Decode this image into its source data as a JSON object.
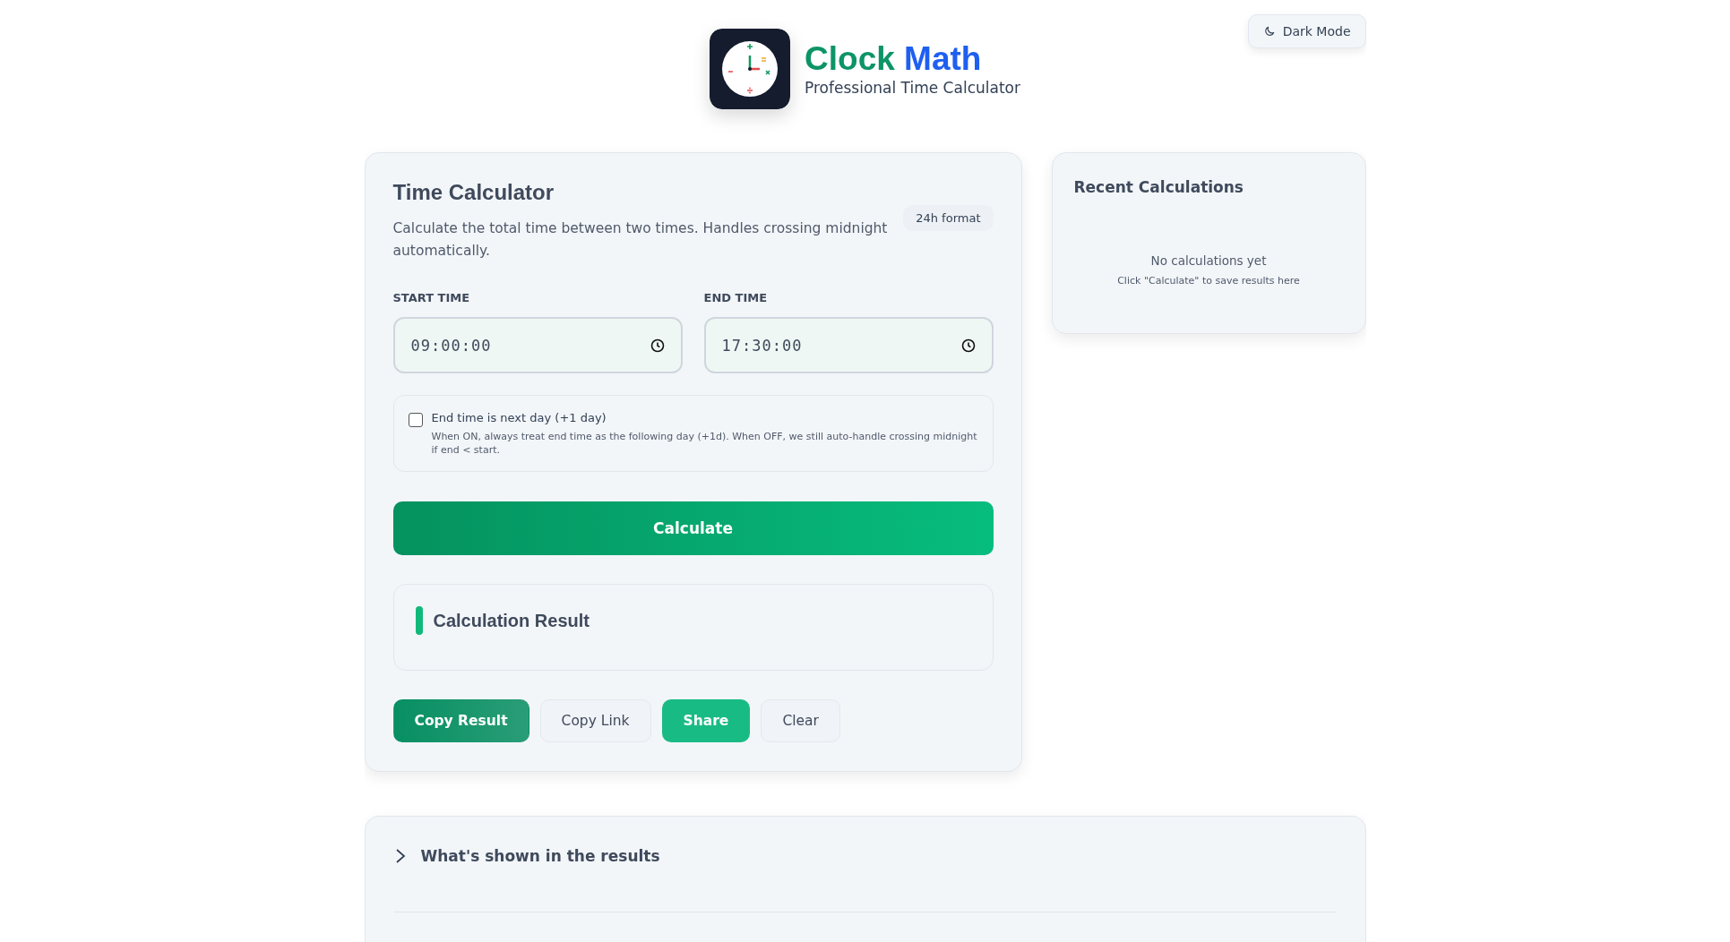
{
  "header": {
    "title_part1": "Clock",
    "title_part2": "Math",
    "subtitle": "Professional Time Calculator",
    "theme_button": "Dark Mode"
  },
  "calculator": {
    "title": "Time Calculator",
    "badge": "24h format",
    "description": "Calculate the total time between two times. Handles crossing midnight automatically.",
    "fields": [
      {
        "label": "START TIME",
        "value": "09:00:00"
      },
      {
        "label": "END TIME",
        "value": "17:30:00"
      }
    ],
    "next_day": {
      "label": "End time is next day (+1 day)",
      "hint": "When ON, always treat end time as the following day (+1d). When OFF, we still auto-handle crossing midnight if end < start.",
      "checked": false
    },
    "calculate_button": "Calculate",
    "result_title": "Calculation Result",
    "actions": [
      {
        "label": "Copy Result",
        "kind": "primary"
      },
      {
        "label": "Copy Link",
        "kind": "secondary"
      },
      {
        "label": "Share",
        "kind": "accent"
      },
      {
        "label": "Clear",
        "kind": "secondary"
      }
    ]
  },
  "recent": {
    "title": "Recent Calculations",
    "empty_title": "No calculations yet",
    "empty_hint": "Click \"Calculate\" to save results here"
  },
  "details": {
    "title": "What's shown in the results",
    "expanded": false
  }
}
